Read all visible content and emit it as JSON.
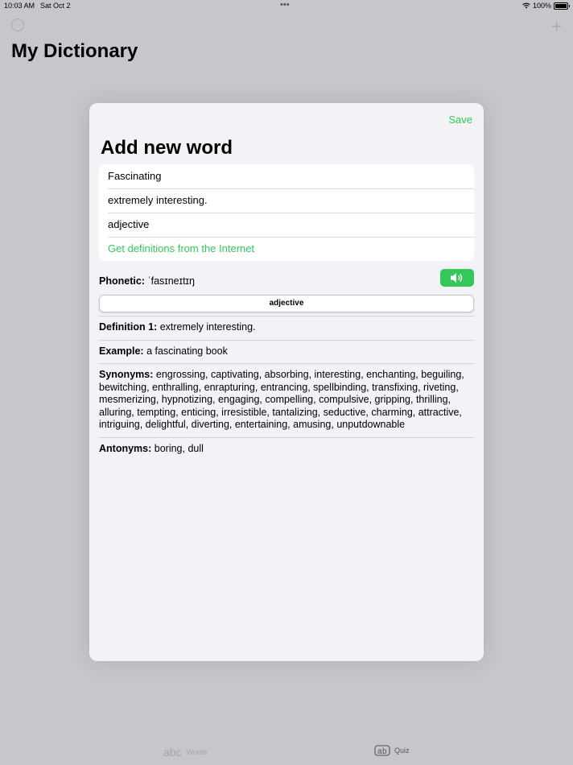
{
  "status": {
    "time": "10:03 AM",
    "date": "Sat Oct 2",
    "dots": "•••",
    "battery": "100%"
  },
  "background": {
    "title": "My Dictionary",
    "left_icon": "ellipsis-circle-icon",
    "right_icon": "+"
  },
  "modal": {
    "save_label": "Save",
    "title": "Add new word",
    "fields": {
      "word": "Fascinating",
      "definition": "extremely interesting.",
      "part_of_speech": "adjective",
      "fetch_link": "Get definitions from the Internet"
    },
    "phonetic_label": "Phonetic:",
    "phonetic_value": "ˈfasɪneɪtɪŋ",
    "segment_selected": "adjective",
    "definition_label": "Definition 1:",
    "definition_value": "extremely interesting.",
    "example_label": "Example:",
    "example_value": "a fascinating book",
    "synonyms_label": "Synonyms:",
    "synonyms_value": "engrossing, captivating, absorbing, interesting, enchanting, beguiling, bewitching, enthralling, enrapturing, entrancing, spellbinding, transfixing, riveting, mesmerizing, hypnotizing, engaging, compelling, compulsive, gripping, thrilling, alluring, tempting, enticing, irresistible, tantalizing, seductive, charming, attractive, intriguing, delightful, diverting, entertaining, amusing, unputdownable",
    "antonyms_label": "Antonyms:",
    "antonyms_value": "boring, dull"
  },
  "tabs": {
    "words_icon": "abc",
    "words_label": "Words",
    "quiz_label": "Quiz"
  },
  "colors": {
    "accent": "#34c759",
    "modal_bg": "#f2f2f7",
    "dim_bg": "#c7c7cb"
  }
}
